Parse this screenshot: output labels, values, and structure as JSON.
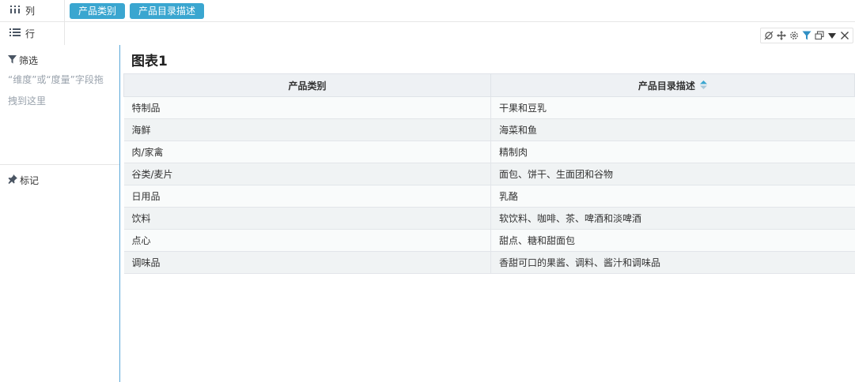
{
  "shelves": {
    "columns": {
      "label": "列",
      "pills": [
        "产品类别",
        "产品目录描述"
      ]
    },
    "rows": {
      "label": "行"
    }
  },
  "sidebar": {
    "filter": {
      "title": "筛选",
      "hint": "“维度”或“度量”字段拖拽到这里"
    },
    "marks": {
      "title": "标记"
    }
  },
  "toolbar": {
    "icons": [
      "unlink-icon",
      "move-icon",
      "settings-icon",
      "filter-icon",
      "window-icon",
      "caret-down-icon",
      "close-icon"
    ],
    "accent": "#3aa6d0"
  },
  "chart": {
    "title": "图表1",
    "headers": [
      "产品类别",
      "产品目录描述"
    ],
    "rows": [
      [
        "特制品",
        "干果和豆乳"
      ],
      [
        "海鲜",
        "海菜和鱼"
      ],
      [
        "肉/家禽",
        "精制肉"
      ],
      [
        "谷类/麦片",
        "面包、饼干、生面团和谷物"
      ],
      [
        "日用品",
        "乳酪"
      ],
      [
        "饮料",
        "软饮料、咖啡、茶、啤酒和淡啤酒"
      ],
      [
        "点心",
        "甜点、糖和甜面包"
      ],
      [
        "调味品",
        "香甜可口的果酱、调料、酱汁和调味品"
      ]
    ]
  }
}
